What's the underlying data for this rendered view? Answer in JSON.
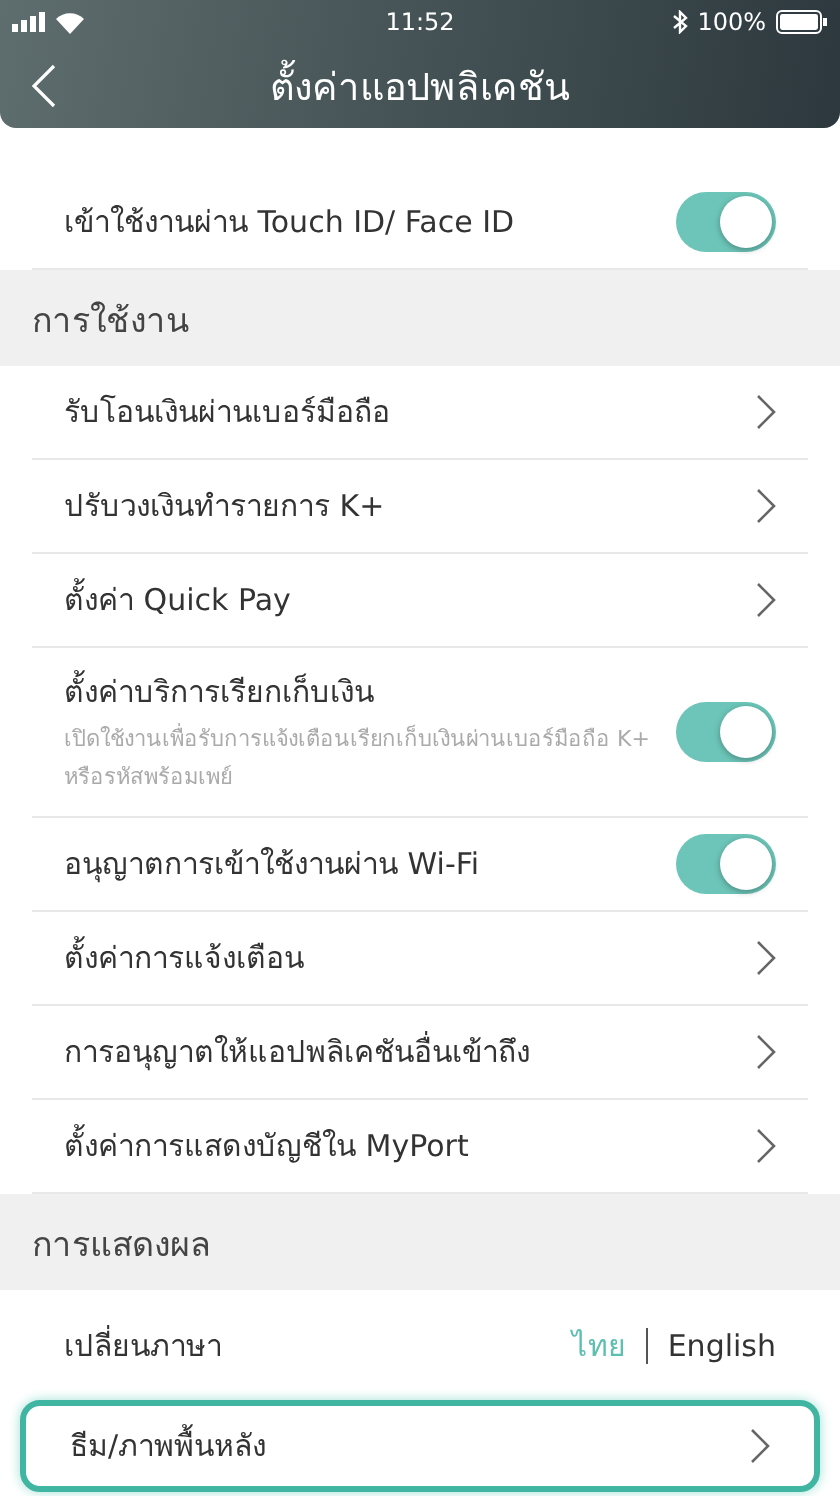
{
  "status_bar": {
    "time": "11:52",
    "battery": "100%"
  },
  "header": {
    "title": "ตั้งค่าแอปพลิเคชัน"
  },
  "sections": [
    {
      "items": [
        {
          "kind": "toggle",
          "label": "เข้าใช้งานผ่าน Touch ID/ Face ID",
          "on": true
        }
      ]
    },
    {
      "title": "การใช้งาน",
      "items": [
        {
          "kind": "nav",
          "label": "รับโอนเงินผ่านเบอร์มือถือ"
        },
        {
          "kind": "nav",
          "label": "ปรับวงเงินทำรายการ K+"
        },
        {
          "kind": "nav",
          "label": "ตั้งค่า Quick Pay"
        },
        {
          "kind": "toggle",
          "label": "ตั้งค่าบริการเรียกเก็บเงิน",
          "description": "เปิดใช้งานเพื่อรับการแจ้งเตือนเรียกเก็บเงินผ่านเบอร์มือถือ K+ หรือรหัสพร้อมเพย์",
          "on": true
        },
        {
          "kind": "toggle",
          "label": "อนุญาตการเข้าใช้งานผ่าน Wi-Fi",
          "on": true
        },
        {
          "kind": "nav",
          "label": "ตั้งค่าการแจ้งเตือน"
        },
        {
          "kind": "nav",
          "label": "การอนุญาตให้แอปพลิเคชันอื่นเข้าถึง"
        },
        {
          "kind": "nav",
          "label": "ตั้งค่าการแสดงบัญชีใน MyPort"
        }
      ]
    },
    {
      "title": "การแสดงผล",
      "items": [
        {
          "kind": "language",
          "label": "เปลี่ยนภาษา",
          "options": [
            {
              "label": "ไทย",
              "selected": true
            },
            {
              "label": "English",
              "selected": false
            }
          ]
        },
        {
          "kind": "nav",
          "label": "ธีม/ภาพพื้นหลัง",
          "highlighted": true
        }
      ]
    }
  ]
}
